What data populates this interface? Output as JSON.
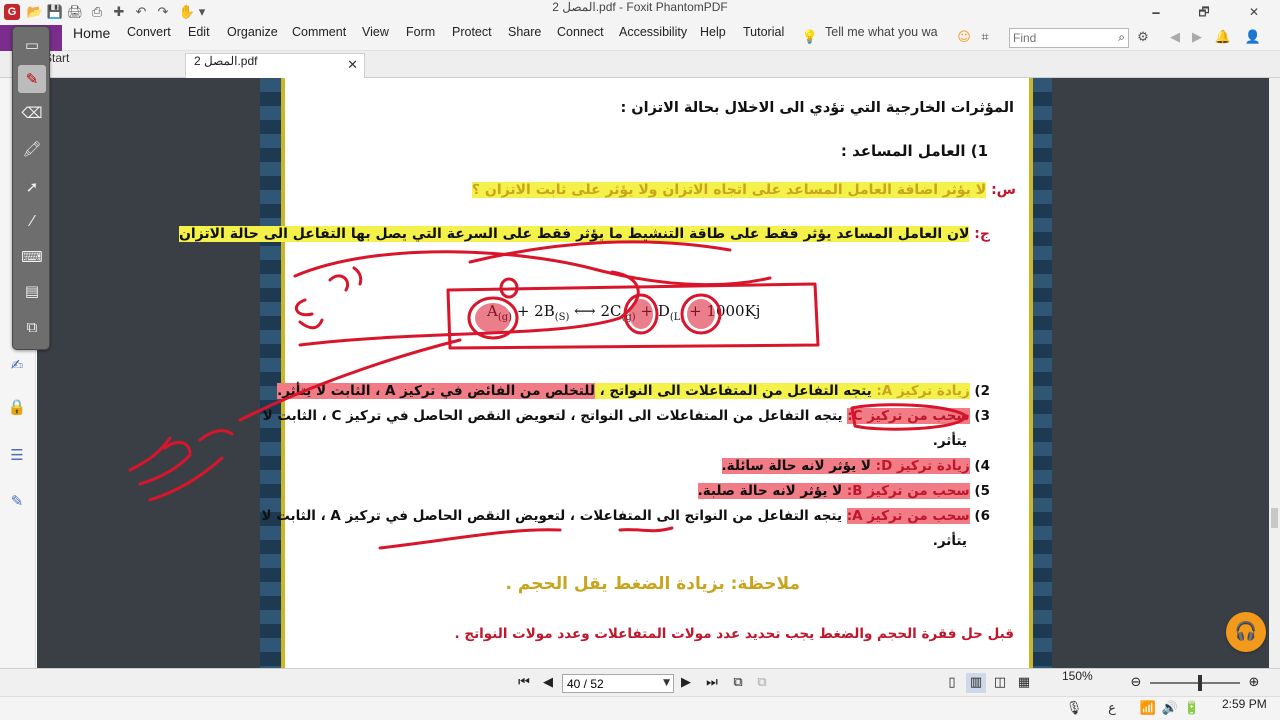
{
  "window": {
    "title": "المصل 2.pdf - Foxit PhantomPDF",
    "app_logo": "G",
    "minimize": "🗕",
    "restore": "🗗",
    "close": "✕"
  },
  "quick_access": [
    "📂",
    "💾",
    "🖨",
    "⎙",
    "✚",
    "↶",
    "↷",
    "✋",
    "▾"
  ],
  "menu": {
    "items": [
      "Home",
      "Convert",
      "Edit",
      "Organize",
      "Comment",
      "View",
      "Form",
      "Protect",
      "Share",
      "Connect",
      "Accessibility",
      "Help",
      "Tutorial"
    ],
    "tell_me": "Tell me what you wa",
    "find_placeholder": "Find"
  },
  "tabs": {
    "start": "Start",
    "document": "المصل 2.pdf",
    "close": "✕"
  },
  "page": {
    "heading": "المؤثرات الخارجية التي تؤدي الى الاخلال بحالة الاتزان :",
    "item1": "1)  العامل المساعد :",
    "question_prefix": "س: ",
    "question": "لا يؤثر اضافة العامل المساعد على اتجاه الاتزان ولا يؤثر على ثابت الاتزان ؟",
    "answer_prefix": "ج: ",
    "answer": "لان العامل المساعد يؤثر فقط على طاقة التنشيط ما يؤثر فقط على السرعة التي يصل بها التفاعل الى حالة الاتزان",
    "equation": {
      "r1": "A",
      "r1_state": "(g)",
      "plus1": " + ",
      "r2": "2B",
      "r2_state": "(S)",
      "arrow": " ⟷ ",
      "p1": "2C",
      "p1_state": "(g)",
      "plus2": " + ",
      "p2": "D",
      "p2_state": "(L)",
      "energy": " + 1000Kj"
    },
    "item2_num": "2)",
    "item2_label": "زيادة تركيز A:",
    "item2_text": " يتجه التفاعل من المتفاعلات الى النواتج ، ",
    "item2_text2": "للتخلص من الفائض في تركيز A ، الثابت لا يتأثر.",
    "item3_num": "3)",
    "item3_label": "سحب من تركيز C:",
    "item3_text": " يتجه التفاعل من المتفاعلات الى النواتج ، لتعويض النقص الحاصل  في تركيز  C ، الثابت لا",
    "item3_cont": "يتأثر.",
    "item4_num": "4)",
    "item4_label": "زيادة تركيز D:",
    "item4_text": " لا يؤثر لانه حالة سائلة.",
    "item5_num": "5)",
    "item5_label": "سحب من تركيز B:",
    "item5_text": " لا يؤثر لانه حالة صلبة.",
    "item6_num": "6)",
    "item6_label": "سحب من تركيز A:",
    "item6_text": " يتجه التفاعل من النواتج الى المتفاعلات ، لتعويض النقص الحاصل  في تركيز  A ، الثابت لا",
    "item6_cont": "يتأثر.",
    "note": "ملاحظة: بزيادة الضغط يقل الحجم .",
    "footer_line": "قبل حل فقرة الحجم والضغط يجب تحديد عدد مولات المتفاعلات وعدد مولات النواتج ."
  },
  "navigation": {
    "first": "⏮",
    "prev": "◀",
    "page_value": "40 / 52",
    "next": "▶",
    "last": "⏭",
    "zoom": "150%",
    "zoom_level": 0.55
  },
  "taskbar": {
    "time": "2:59 PM",
    "lang": "ع"
  },
  "colors": {
    "file_tab": "#7a2d8c",
    "highlight_yellow": "#f4f24a",
    "highlight_pink": "#f17c86",
    "ink_red": "#d9152b",
    "page_border": "#c9b827"
  }
}
